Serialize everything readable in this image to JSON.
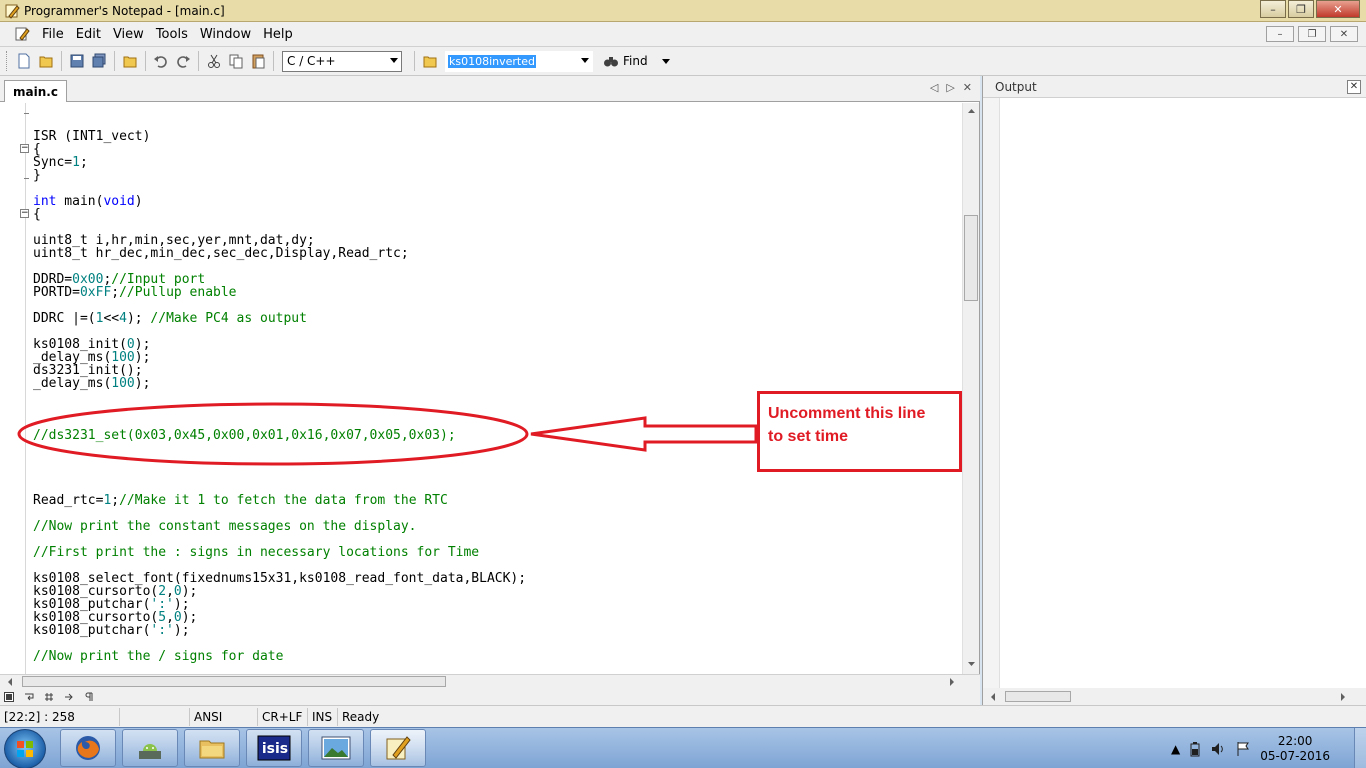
{
  "window": {
    "title": "Programmer's Notepad - [main.c]",
    "minimize_glyph": "–",
    "maximize_glyph": "❐",
    "close_glyph": "✕"
  },
  "menu": {
    "items": [
      "File",
      "Edit",
      "View",
      "Tools",
      "Window",
      "Help"
    ],
    "mdi_minimize": "–",
    "mdi_restore": "❐",
    "mdi_close": "✕"
  },
  "toolbar": {
    "scheme_selected": "C / C++",
    "search_value": "ks0108inverted",
    "find_label": "Find"
  },
  "editor": {
    "tab_label": "main.c",
    "tab_prev": "◁",
    "tab_next": "▷",
    "tab_close": "✕",
    "lines": [
      {
        "segments": [
          {
            "t": "ISR (INT1_vect)",
            "c": ""
          }
        ]
      },
      {
        "segments": [
          {
            "t": "{",
            "c": ""
          }
        ]
      },
      {
        "segments": [
          {
            "t": "Sync=",
            "c": ""
          },
          {
            "t": "1",
            "c": "num"
          },
          {
            "t": ";",
            "c": ""
          }
        ]
      },
      {
        "segments": [
          {
            "t": "}",
            "c": ""
          }
        ]
      },
      {
        "segments": [
          {
            "t": "int",
            "c": "kw"
          },
          {
            "t": " main(",
            "c": ""
          },
          {
            "t": "void",
            "c": "kw"
          },
          {
            "t": ")",
            "c": ""
          }
        ]
      },
      {
        "segments": [
          {
            "t": "{",
            "c": ""
          }
        ]
      },
      {
        "segments": [
          {
            "t": "uint8_t i,hr,min,sec,yer,mnt,dat,dy;",
            "c": ""
          }
        ]
      },
      {
        "segments": [
          {
            "t": "uint8_t hr_dec,min_dec,sec_dec,Display,Read_rtc;",
            "c": ""
          }
        ]
      },
      {
        "segments": [
          {
            "t": "DDRD=",
            "c": ""
          },
          {
            "t": "0x00",
            "c": "num"
          },
          {
            "t": ";",
            "c": ""
          },
          {
            "t": "//Input port",
            "c": "cm"
          }
        ]
      },
      {
        "segments": [
          {
            "t": "PORTD=",
            "c": ""
          },
          {
            "t": "0xFF",
            "c": "num"
          },
          {
            "t": ";",
            "c": ""
          },
          {
            "t": "//Pullup enable",
            "c": "cm"
          }
        ]
      },
      {
        "segments": [
          {
            "t": "DDRC |=(",
            "c": ""
          },
          {
            "t": "1",
            "c": "num"
          },
          {
            "t": "<<",
            "c": ""
          },
          {
            "t": "4",
            "c": "num"
          },
          {
            "t": "); ",
            "c": ""
          },
          {
            "t": "//Make PC4 as output",
            "c": "cm"
          }
        ]
      },
      {
        "segments": [
          {
            "t": "ks0108_init(",
            "c": ""
          },
          {
            "t": "0",
            "c": "num"
          },
          {
            "t": ");",
            "c": ""
          }
        ]
      },
      {
        "segments": [
          {
            "t": "_delay_ms(",
            "c": ""
          },
          {
            "t": "100",
            "c": "num"
          },
          {
            "t": ");",
            "c": ""
          }
        ]
      },
      {
        "segments": [
          {
            "t": "ds3231_init();",
            "c": ""
          }
        ]
      },
      {
        "segments": [
          {
            "t": "_delay_ms(",
            "c": ""
          },
          {
            "t": "100",
            "c": "num"
          },
          {
            "t": ");",
            "c": ""
          }
        ]
      },
      {
        "segments": [
          {
            "t": "//ds3231_set(0x03,0x45,0x00,0x01,0x16,0x07,0x05,0x03);",
            "c": "cm"
          }
        ]
      },
      {
        "segments": [
          {
            "t": "Read_rtc=",
            "c": ""
          },
          {
            "t": "1",
            "c": "num"
          },
          {
            "t": ";",
            "c": ""
          },
          {
            "t": "//Make it 1 to fetch the data from the RTC",
            "c": "cm"
          }
        ]
      },
      {
        "segments": [
          {
            "t": "//Now print the constant messages on the display.",
            "c": "cm"
          }
        ]
      },
      {
        "segments": [
          {
            "t": "//First print the : signs in necessary locations for Time",
            "c": "cm"
          }
        ]
      },
      {
        "segments": [
          {
            "t": "ks0108_select_font(fixednums15x31,ks0108_read_font_data,BLACK);",
            "c": ""
          }
        ]
      },
      {
        "segments": [
          {
            "t": "ks0108_cursorto(",
            "c": ""
          },
          {
            "t": "2",
            "c": "num"
          },
          {
            "t": ",",
            "c": ""
          },
          {
            "t": "0",
            "c": "num"
          },
          {
            "t": ");",
            "c": ""
          }
        ]
      },
      {
        "segments": [
          {
            "t": "ks0108_putchar(",
            "c": ""
          },
          {
            "t": "':'",
            "c": "num"
          },
          {
            "t": ");",
            "c": ""
          }
        ]
      },
      {
        "segments": [
          {
            "t": "ks0108_cursorto(",
            "c": ""
          },
          {
            "t": "5",
            "c": "num"
          },
          {
            "t": ",",
            "c": ""
          },
          {
            "t": "0",
            "c": "num"
          },
          {
            "t": ");",
            "c": ""
          }
        ]
      },
      {
        "segments": [
          {
            "t": "ks0108_putchar(",
            "c": ""
          },
          {
            "t": "':'",
            "c": "num"
          },
          {
            "t": ");",
            "c": ""
          }
        ]
      },
      {
        "segments": [
          {
            "t": "//Now print the / signs for date",
            "c": "cm"
          }
        ]
      }
    ]
  },
  "annotation": {
    "callout_line1": "Uncomment this line",
    "callout_line2": "to set time",
    "color": "#e01b24"
  },
  "output": {
    "title": "Output",
    "close_glyph": "✕"
  },
  "status": {
    "position": "[22:2] : 258",
    "encoding": "ANSI",
    "line_endings": "CR+LF",
    "mode": "INS",
    "state": "Ready"
  },
  "taskbar": {
    "apps": [
      "firefox-icon",
      "android-studio-icon",
      "file-explorer-icon",
      "isis-icon",
      "picture-viewer-icon",
      "programmers-notepad-icon"
    ],
    "isis_label": "isis",
    "time": "22:00",
    "date": "05-07-2016"
  },
  "colors": {
    "keyword": "#0000ff",
    "number": "#008080",
    "comment": "#008000",
    "callout": "#e01b24"
  }
}
